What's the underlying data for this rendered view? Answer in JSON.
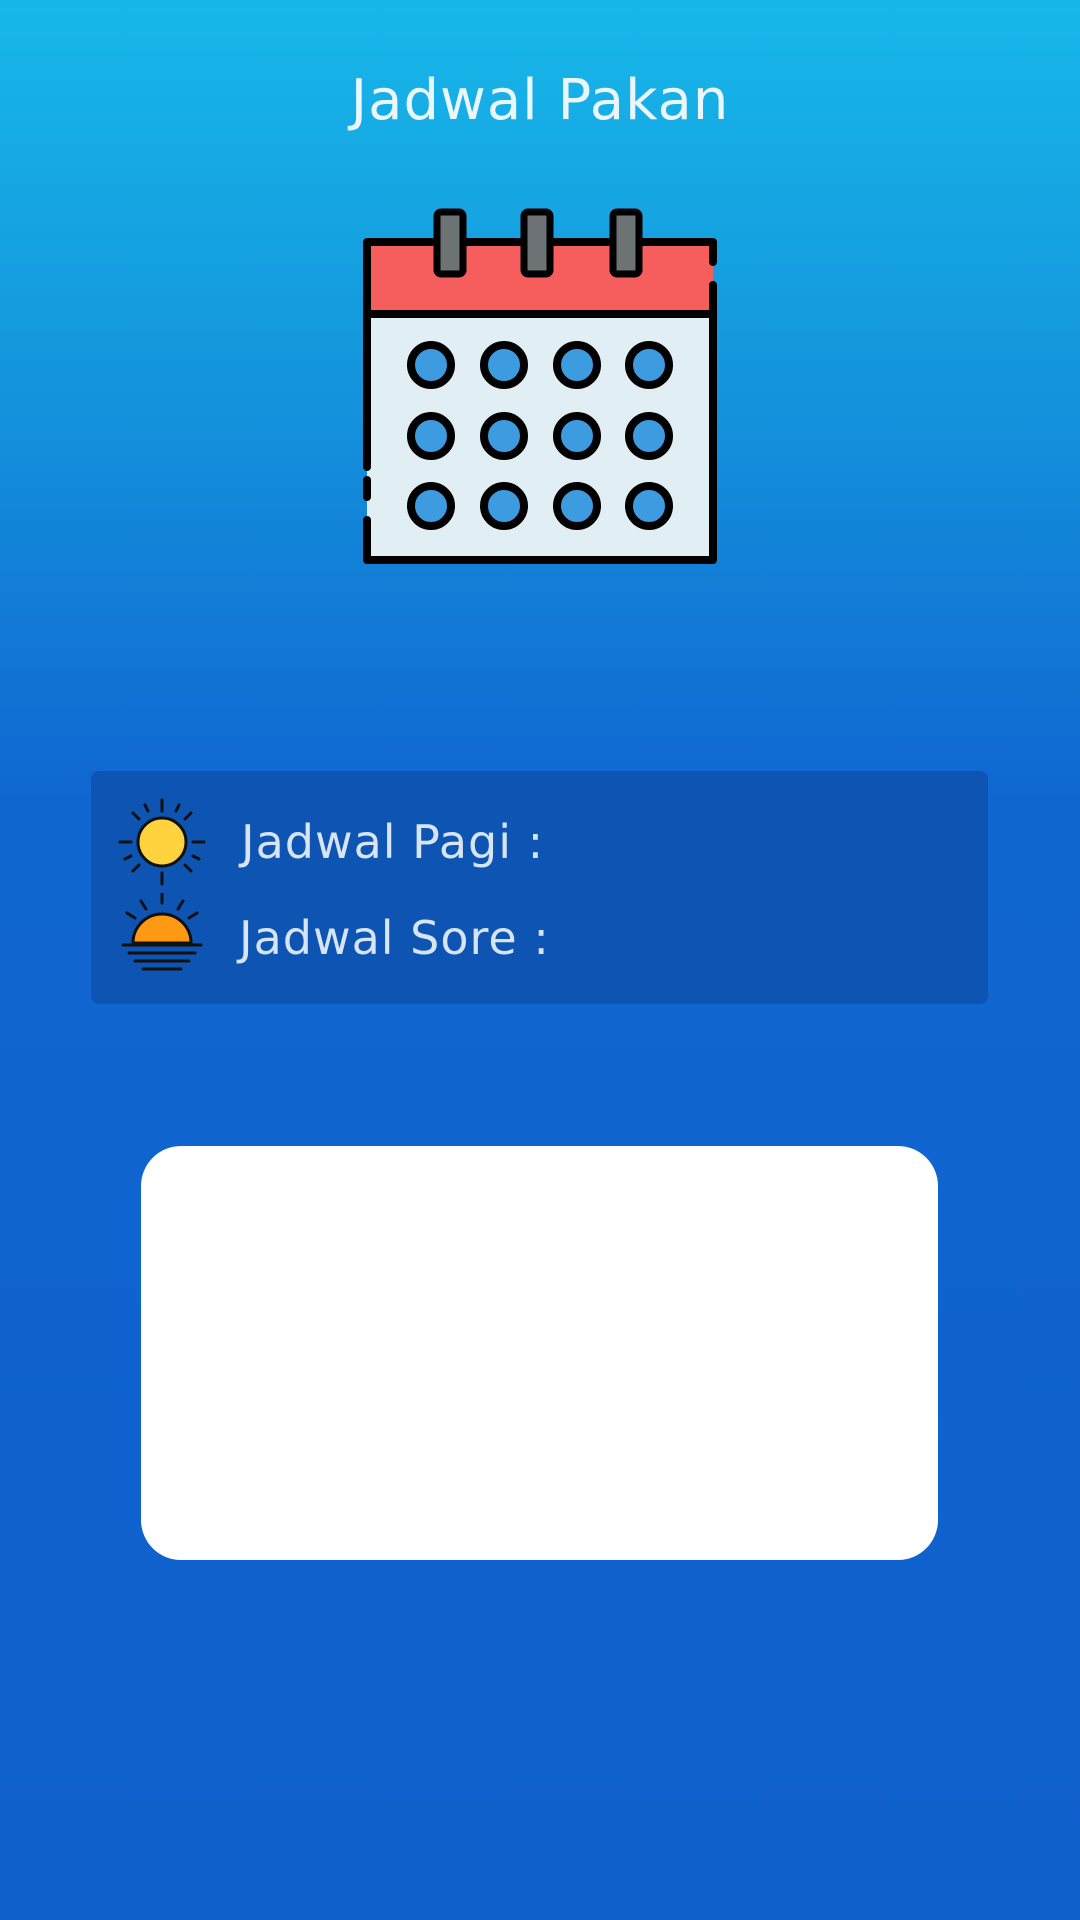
{
  "header": {
    "title": "Jadwal Pakan"
  },
  "hero": {
    "icon": "calendar-icon"
  },
  "schedule": {
    "morning": {
      "icon": "sun-icon",
      "label": "Jadwal Pagi :"
    },
    "evening": {
      "icon": "sunset-icon",
      "label": "Jadwal Sore :"
    }
  },
  "colors": {
    "gradient_top": "#17b8e9",
    "gradient_bottom": "#0f60cc",
    "panel": "#0d54b3",
    "calendar_header": "#f65e5e",
    "calendar_dot": "#3d9be0",
    "sun": "#ffd33d",
    "sunset": "#ff9812"
  }
}
